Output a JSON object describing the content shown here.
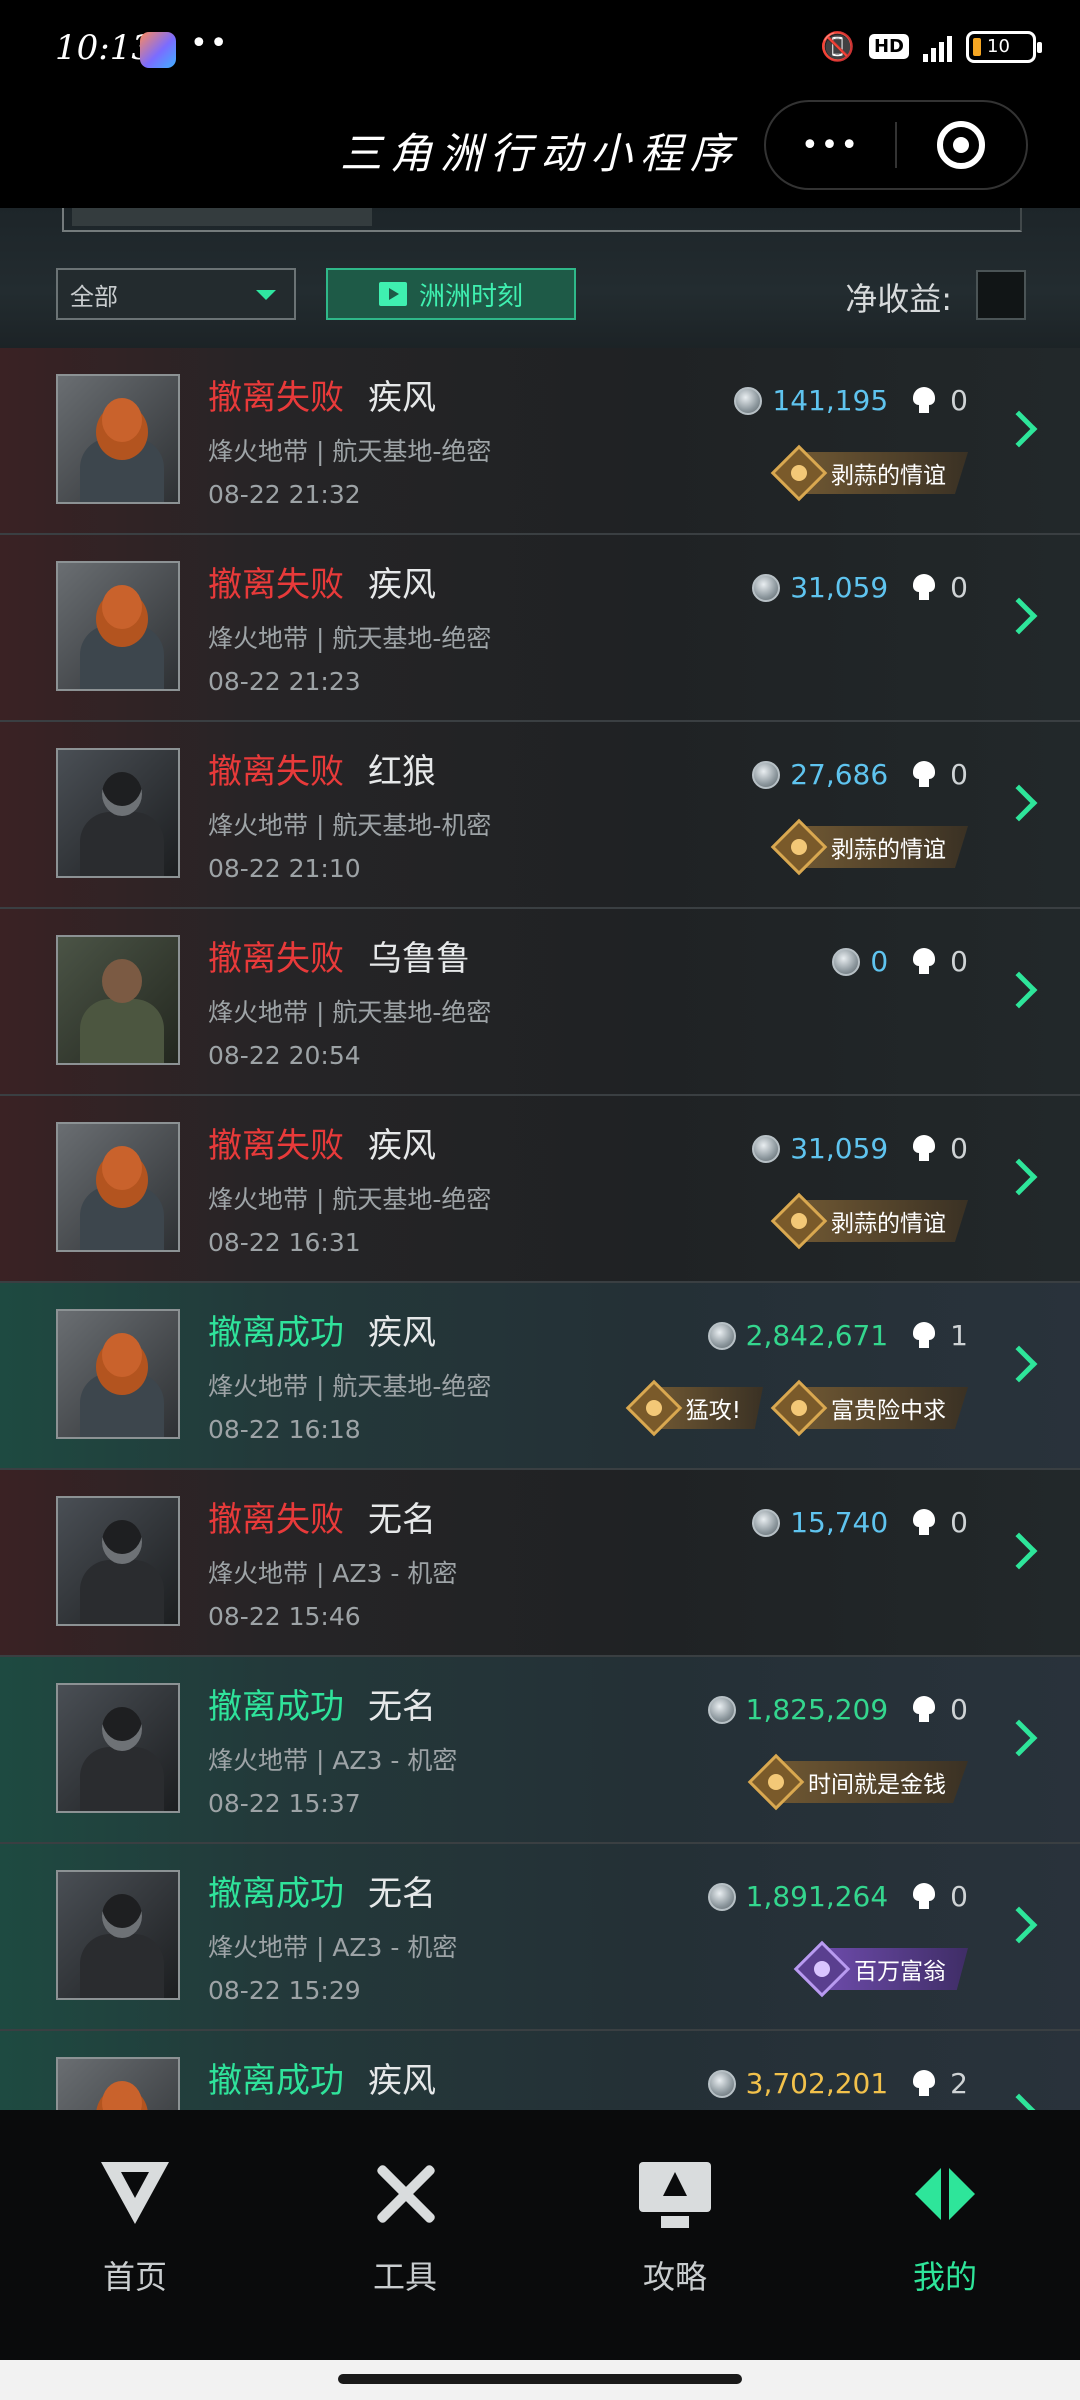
{
  "status_bar": {
    "time": "10:13",
    "dots": "••",
    "hd": "HD",
    "battery": "10"
  },
  "header": {
    "title": "三角洲行动小程序",
    "more_label": "•••"
  },
  "filters": {
    "mode_select": "全部",
    "moments_button": "洲洲时刻",
    "net_income_label": "净收益:"
  },
  "records": [
    {
      "status": "撤离失败",
      "result": "fail",
      "operator": "疾风",
      "map": "烽火地带 | 航天基地-绝密",
      "time": "08-22 21:32",
      "value": "141,195",
      "kills": "0",
      "badges": [
        "剥蒜的情谊"
      ],
      "avatar": "red"
    },
    {
      "status": "撤离失败",
      "result": "fail",
      "operator": "疾风",
      "map": "烽火地带 | 航天基地-绝密",
      "time": "08-22 21:23",
      "value": "31,059",
      "kills": "0",
      "badges": [],
      "avatar": "red"
    },
    {
      "status": "撤离失败",
      "result": "fail",
      "operator": "红狼",
      "map": "烽火地带 | 航天基地-机密",
      "time": "08-22 21:10",
      "value": "27,686",
      "kills": "0",
      "badges": [
        "剥蒜的情谊"
      ],
      "avatar": "dark"
    },
    {
      "status": "撤离失败",
      "result": "fail",
      "operator": "乌鲁鲁",
      "map": "烽火地带 | 航天基地-绝密",
      "time": "08-22 20:54",
      "value": "0",
      "kills": "0",
      "badges": [],
      "avatar": "green"
    },
    {
      "status": "撤离失败",
      "result": "fail",
      "operator": "疾风",
      "map": "烽火地带 | 航天基地-绝密",
      "time": "08-22 16:31",
      "value": "31,059",
      "kills": "0",
      "badges": [
        "剥蒜的情谊"
      ],
      "avatar": "red"
    },
    {
      "status": "撤离成功",
      "result": "success",
      "operator": "疾风",
      "map": "烽火地带 | 航天基地-绝密",
      "time": "08-22 16:18",
      "value": "2,842,671",
      "kills": "1",
      "badges": [
        "猛攻!",
        "富贵险中求"
      ],
      "avatar": "red"
    },
    {
      "status": "撤离失败",
      "result": "fail",
      "operator": "无名",
      "map": "烽火地带 | AZ3 - 机密",
      "time": "08-22 15:46",
      "value": "15,740",
      "kills": "0",
      "badges": [],
      "avatar": "dark"
    },
    {
      "status": "撤离成功",
      "result": "success",
      "operator": "无名",
      "map": "烽火地带 | AZ3 - 机密",
      "time": "08-22 15:37",
      "value": "1,825,209",
      "kills": "0",
      "badges": [
        "时间就是金钱"
      ],
      "avatar": "dark"
    },
    {
      "status": "撤离成功",
      "result": "success",
      "operator": "无名",
      "map": "烽火地带 | AZ3 - 机密",
      "time": "08-22 15:29",
      "value": "1,891,264",
      "kills": "0",
      "badges": [
        "百万富翁"
      ],
      "badge_style": "purple",
      "avatar": "dark"
    },
    {
      "status": "撤离成功",
      "result": "success",
      "operator": "疾风",
      "map": "",
      "time": "",
      "value": "3,702,201",
      "kills": "2",
      "badges": [],
      "value_style": "gold",
      "avatar": "red"
    }
  ],
  "tabs": [
    {
      "label": "首页",
      "icon": "home-logo-icon"
    },
    {
      "label": "工具",
      "icon": "tools-icon"
    },
    {
      "label": "攻略",
      "icon": "guide-icon"
    },
    {
      "label": "我的",
      "icon": "mine-icon",
      "active": true
    }
  ],
  "colors": {
    "accent": "#2ee59a",
    "fail": "#e83a3a",
    "success": "#2fe39b",
    "value": "#5fc4ef"
  }
}
